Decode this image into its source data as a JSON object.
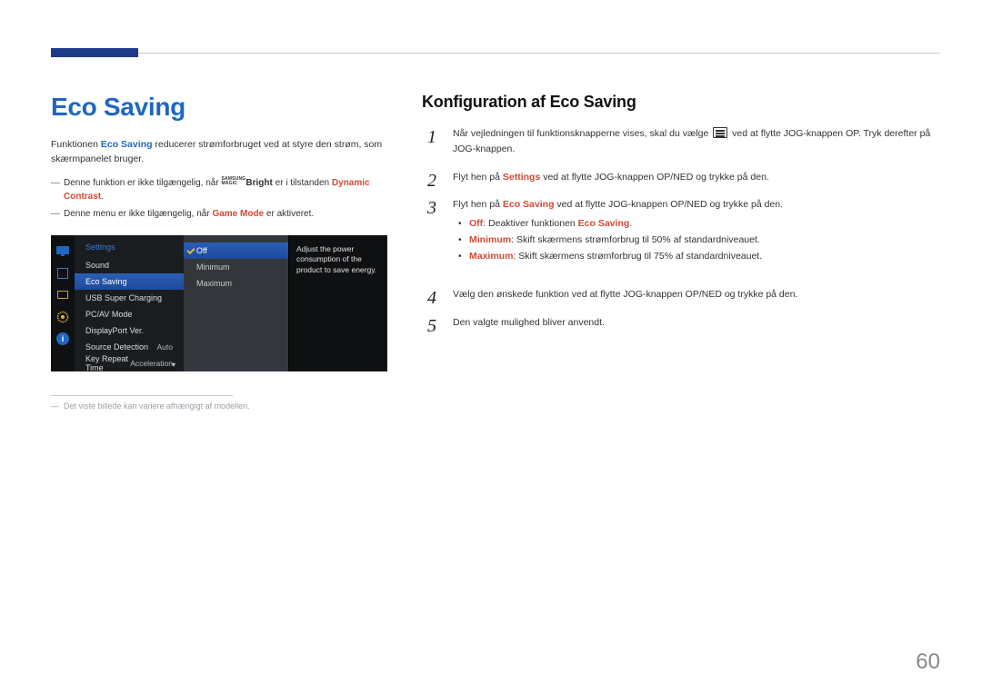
{
  "page_number": "60",
  "left": {
    "heading": "Eco Saving",
    "intro_pre": "Funktionen ",
    "intro_hl": "Eco Saving",
    "intro_post": " reducerer strømforbruget ved at styre den strøm, som skærmpanelet bruger.",
    "note1_pre": "Denne funktion er ikke tilgængelig, når ",
    "note1_logo_top": "SAMSUNG",
    "note1_logo_bot": "MAGIC",
    "note1_bright": "Bright",
    "note1_mid": " er i tilstanden ",
    "note1_hl": "Dynamic Contrast",
    "note1_end": ".",
    "note2_pre": "Denne menu er ikke tilgængelig, når ",
    "note2_hl": "Game Mode",
    "note2_post": " er aktiveret.",
    "footnote": "Det viste billede kan variere afhængigt af modellen."
  },
  "osd": {
    "title": "Settings",
    "menu": [
      {
        "label": "Sound",
        "value": ""
      },
      {
        "label": "Eco Saving",
        "value": ""
      },
      {
        "label": "USB Super Charging",
        "value": ""
      },
      {
        "label": "PC/AV Mode",
        "value": ""
      },
      {
        "label": "DisplayPort Ver.",
        "value": ""
      },
      {
        "label": "Source Detection",
        "value": "Auto"
      },
      {
        "label": "Key Repeat Time",
        "value": "Acceleration"
      }
    ],
    "sub": [
      "Off",
      "Minimum",
      "Maximum"
    ],
    "desc": "Adjust the power consumption of the product to save energy.",
    "info_glyph": "i"
  },
  "right": {
    "heading": "Konfiguration af Eco Saving",
    "step1_a": "Når vejledningen til funktionsknapperne vises, skal du vælge ",
    "step1_b": " ved at flytte JOG-knappen OP. Tryk derefter på JOG-knappen.",
    "step2_a": "Flyt hen på ",
    "step2_hl": "Settings",
    "step2_b": " ved at flytte JOG-knappen OP/NED og trykke på den.",
    "step3_a": "Flyt hen på ",
    "step3_hl": "Eco Saving",
    "step3_b": " ved at flytte JOG-knappen OP/NED og trykke på den.",
    "bullets": [
      {
        "hl": "Off",
        "sep": ": ",
        "text": "Deaktiver funktionen ",
        "hl2": "Eco Saving",
        "end": "."
      },
      {
        "hl": "Minimum",
        "sep": ": ",
        "text": "Skift skærmens strømforbrug til 50% af standardniveauet.",
        "hl2": "",
        "end": ""
      },
      {
        "hl": "Maximum",
        "sep": ": ",
        "text": "Skift skærmens strømforbrug til 75% af standardniveauet.",
        "hl2": "",
        "end": ""
      }
    ],
    "step4": "Vælg den ønskede funktion ved at flytte JOG-knappen OP/NED og trykke på den.",
    "step5": "Den valgte mulighed bliver anvendt."
  }
}
